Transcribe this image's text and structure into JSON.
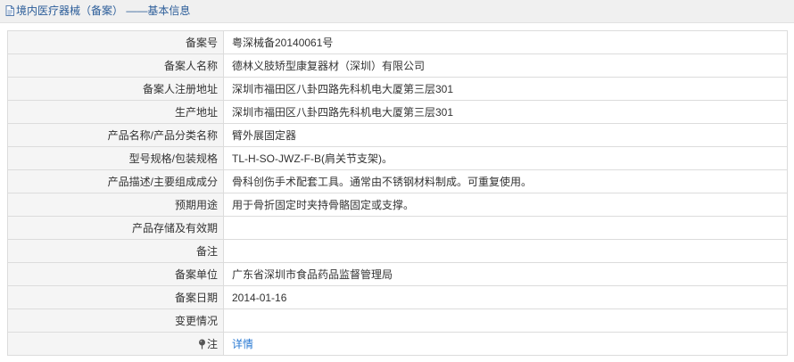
{
  "header": {
    "icon": "document-icon",
    "title": "境内医疗器械（备案） ——基本信息",
    "title_color": "#2b5d99"
  },
  "rows": [
    {
      "label": "备案号",
      "value": "粤深械备20140061号"
    },
    {
      "label": "备案人名称",
      "value": "德林义肢矫型康复器材（深圳）有限公司"
    },
    {
      "label": "备案人注册地址",
      "value": "深圳市福田区八卦四路先科机电大厦第三层301"
    },
    {
      "label": "生产地址",
      "value": "深圳市福田区八卦四路先科机电大厦第三层301"
    },
    {
      "label": "产品名称/产品分类名称",
      "value": "臂外展固定器"
    },
    {
      "label": "型号规格/包装规格",
      "value": "TL-H-SO-JWZ-F-B(肩关节支架)。"
    },
    {
      "label": "产品描述/主要组成成分",
      "value": "骨科创伤手术配套工具。通常由不锈钢材料制成。可重复使用。"
    },
    {
      "label": "预期用途",
      "value": "用于骨折固定时夹持骨骼固定或支撑。"
    },
    {
      "label": "产品存储及有效期",
      "value": ""
    },
    {
      "label": "备注",
      "value": ""
    },
    {
      "label": "备案单位",
      "value": "广东省深圳市食品药品监督管理局"
    },
    {
      "label": "备案日期",
      "value": "2014-01-16"
    },
    {
      "label": "变更情况",
      "value": ""
    }
  ],
  "note_row": {
    "icon": "pin-icon",
    "label": "注",
    "link_text": "详情",
    "link_color": "#2a7ad3"
  }
}
